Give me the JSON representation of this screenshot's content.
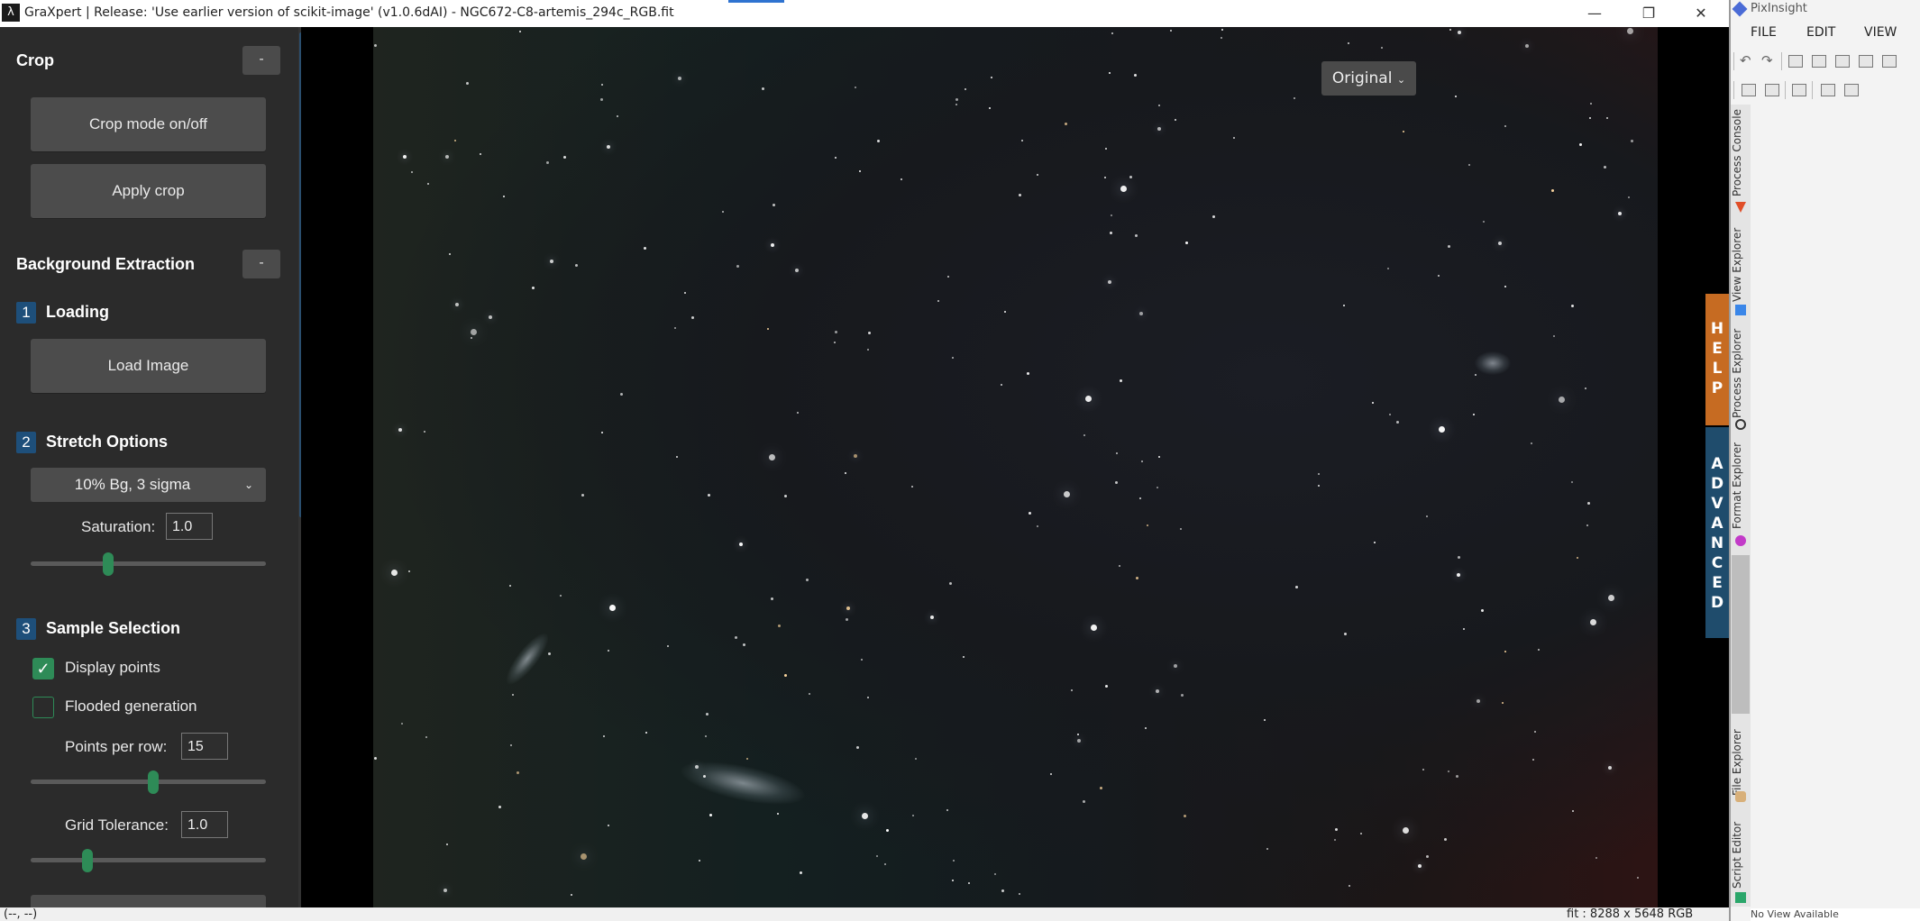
{
  "graxpert": {
    "window_title": "GraXpert | Release: 'Use earlier version of scikit-image' (v1.0.6dAI) - NGC672-C8-artemis_294c_RGB.fit",
    "app_icon": "graxpert-logo",
    "window_controls": {
      "minimize": "—",
      "maximize": "❐",
      "close": "✕"
    },
    "sidebar": {
      "crop": {
        "title": "Crop",
        "collapse_label": "-",
        "crop_mode_button": "Crop mode on/off",
        "apply_crop_button": "Apply crop"
      },
      "background_extraction": {
        "title": "Background Extraction",
        "collapse_label": "-"
      },
      "loading": {
        "step": "1",
        "title": "Loading",
        "load_button": "Load Image"
      },
      "stretch": {
        "step": "2",
        "title": "Stretch Options",
        "selected_option": "10% Bg, 3 sigma",
        "saturation_label": "Saturation:",
        "saturation_value": "1.0",
        "saturation_slider_fraction": 0.33
      },
      "sample_selection": {
        "step": "3",
        "title": "Sample Selection",
        "display_points_label": "Display points",
        "display_points_checked": true,
        "flooded_generation_label": "Flooded generation",
        "flooded_generation_checked": false,
        "points_per_row_label": "Points per row:",
        "points_per_row_value": "15",
        "points_per_row_slider_fraction": 0.52,
        "grid_tolerance_label": "Grid Tolerance:",
        "grid_tolerance_value": "1.0",
        "grid_tolerance_slider_fraction": 0.24
      }
    },
    "canvas": {
      "view_select": "Original",
      "help_tab": "HELP",
      "advanced_tab": "ADVANCED"
    },
    "status": {
      "left": "(--, --)",
      "right": "fit : 8288 x 5648 RGB"
    },
    "colors": {
      "sidebar_bg": "#2b2b2b",
      "accent_green": "#2e8b57",
      "help_orange": "#c66b22",
      "advanced_blue": "#1f4c6c"
    }
  },
  "pixinsight": {
    "title": "PixInsight",
    "menu": [
      "FILE",
      "EDIT",
      "VIEW"
    ],
    "side_tabs": [
      "Process Console",
      "View Explorer",
      "Process Explorer",
      "Format Explorer",
      "File Explorer",
      "Script Editor"
    ],
    "status": "No View Available"
  }
}
